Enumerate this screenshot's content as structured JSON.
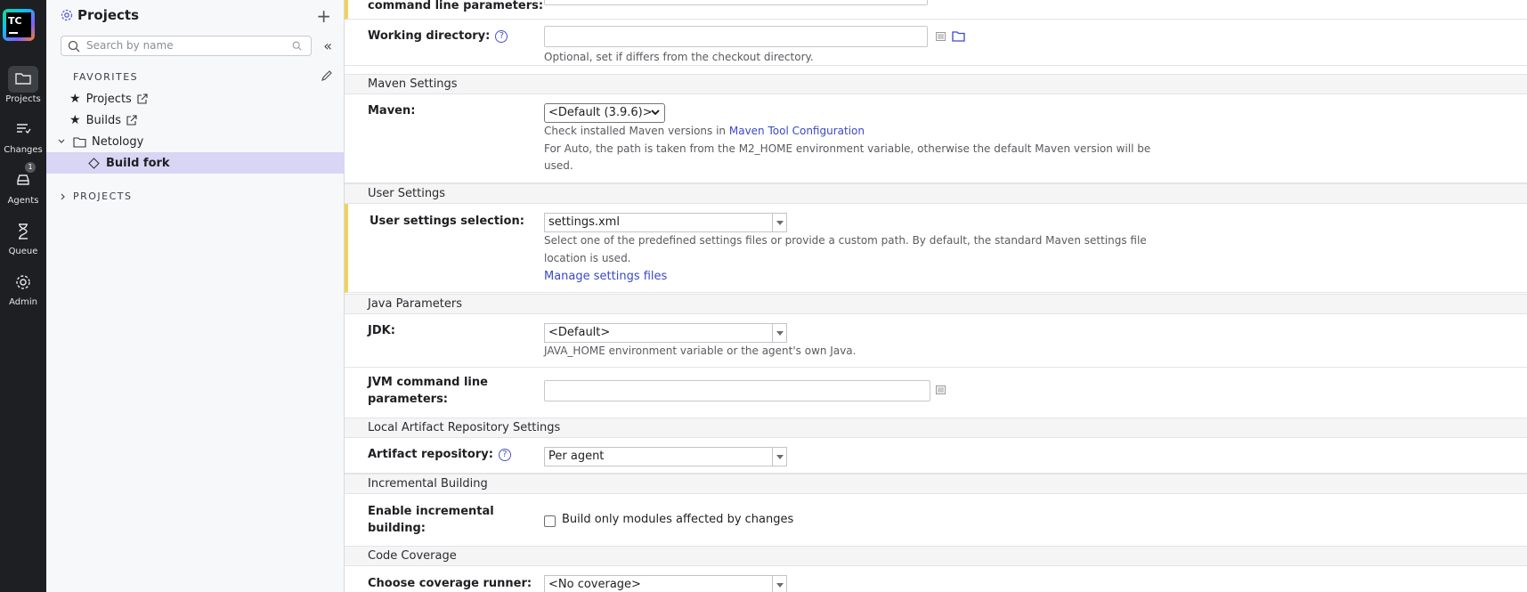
{
  "rail": {
    "logo": "TC",
    "items": [
      {
        "label": "Projects",
        "icon": "folder-icon"
      },
      {
        "label": "Changes",
        "icon": "changes-icon"
      },
      {
        "label": "Agents",
        "icon": "agents-icon",
        "badge": "1"
      },
      {
        "label": "Queue",
        "icon": "hourglass-icon"
      },
      {
        "label": "Admin",
        "icon": "gear-icon"
      }
    ]
  },
  "sidebar": {
    "title": "Projects",
    "search_placeholder": "Search by name",
    "favorites_label": "FAVORITES",
    "favorites": [
      {
        "label": "Projects"
      },
      {
        "label": "Builds"
      }
    ],
    "tree": {
      "folder": "Netology",
      "selected": "Build fork"
    },
    "projects_label": "PROJECTS"
  },
  "form": {
    "top_partial_label": "command line parameters:",
    "working_dir": {
      "label": "Working directory:",
      "help": "Optional, set if differs from the checkout directory."
    },
    "sections": {
      "maven": "Maven Settings",
      "user": "User Settings",
      "java": "Java Parameters",
      "local_repo": "Local Artifact Repository Settings",
      "incremental": "Incremental Building",
      "coverage": "Code Coverage"
    },
    "maven": {
      "label": "Maven:",
      "value": "<Default (3.9.6)>",
      "help_prefix": "Check installed Maven versions in",
      "help_link": "Maven Tool Configuration",
      "help_line2": "For Auto, the path is taken from the M2_HOME environment variable, otherwise the default Maven version will be",
      "help_line3": "used."
    },
    "user_settings": {
      "label": "User settings selection:",
      "value": "settings.xml",
      "help_line1": "Select one of the predefined settings files or provide a custom path. By default, the standard Maven settings file",
      "help_line2": "location is used.",
      "link": "Manage settings files"
    },
    "jdk": {
      "label": "JDK:",
      "value": "<Default>",
      "help": "JAVA_HOME environment variable or the agent's own Java."
    },
    "jvm": {
      "label_line1": "JVM command line",
      "label_line2": "parameters:"
    },
    "artifact_repo": {
      "label": "Artifact repository:",
      "value": "Per agent"
    },
    "incremental": {
      "label_line1": "Enable incremental",
      "label_line2": "building:",
      "checkbox_label": "Build only modules affected by changes"
    },
    "coverage": {
      "label": "Choose coverage runner:",
      "value": "<No coverage>"
    }
  },
  "colors": {
    "rail_bg": "#1e1f22",
    "accent": "#3a49c7",
    "selected_bg": "#d8d5f5",
    "highlight_bar": "#f2d25b"
  }
}
